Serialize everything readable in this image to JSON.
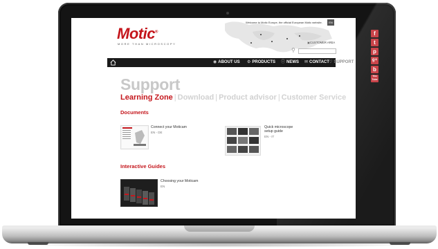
{
  "site": {
    "logo": "Motic",
    "logo_mark": "®",
    "tagline": "MORE THAN MICROSCOPY",
    "welcome": "Welcome to Motic Europe, the official European Motic website.",
    "lang_button": "EN",
    "customer_area": "CUSTOMER AREA"
  },
  "nav": {
    "items": [
      {
        "label": "ABOUT US",
        "icon": "globe-icon"
      },
      {
        "label": "PRODUCTS",
        "icon": "microscope-icon"
      },
      {
        "label": "NEWS",
        "icon": "info-icon"
      },
      {
        "label": "CONTACT",
        "icon": "mail-icon"
      },
      {
        "label": "SUPPORT",
        "icon": "chat-icon"
      }
    ]
  },
  "page": {
    "title": "Support",
    "subnav": [
      "Learning Zone",
      "Download",
      "Product advisor",
      "Customer Service"
    ],
    "sections": {
      "documents": "Documents",
      "guides": "Interactive Guides"
    },
    "documents": [
      {
        "title": "Connect your Moticam",
        "lang": "EN - DE"
      },
      {
        "title": "Quick microscope setup guide",
        "lang": "EN - IT"
      }
    ],
    "guides": [
      {
        "title": "Choosing your Moticam",
        "lang": "EN"
      }
    ]
  },
  "social": [
    "f",
    "t",
    "p",
    "g+",
    "b",
    "You Tube"
  ],
  "colors": {
    "brand_red": "#c4161c",
    "nav_bg": "#1a1a1a",
    "title_grey": "#c8c8c8",
    "social_red": "#c9444a"
  }
}
